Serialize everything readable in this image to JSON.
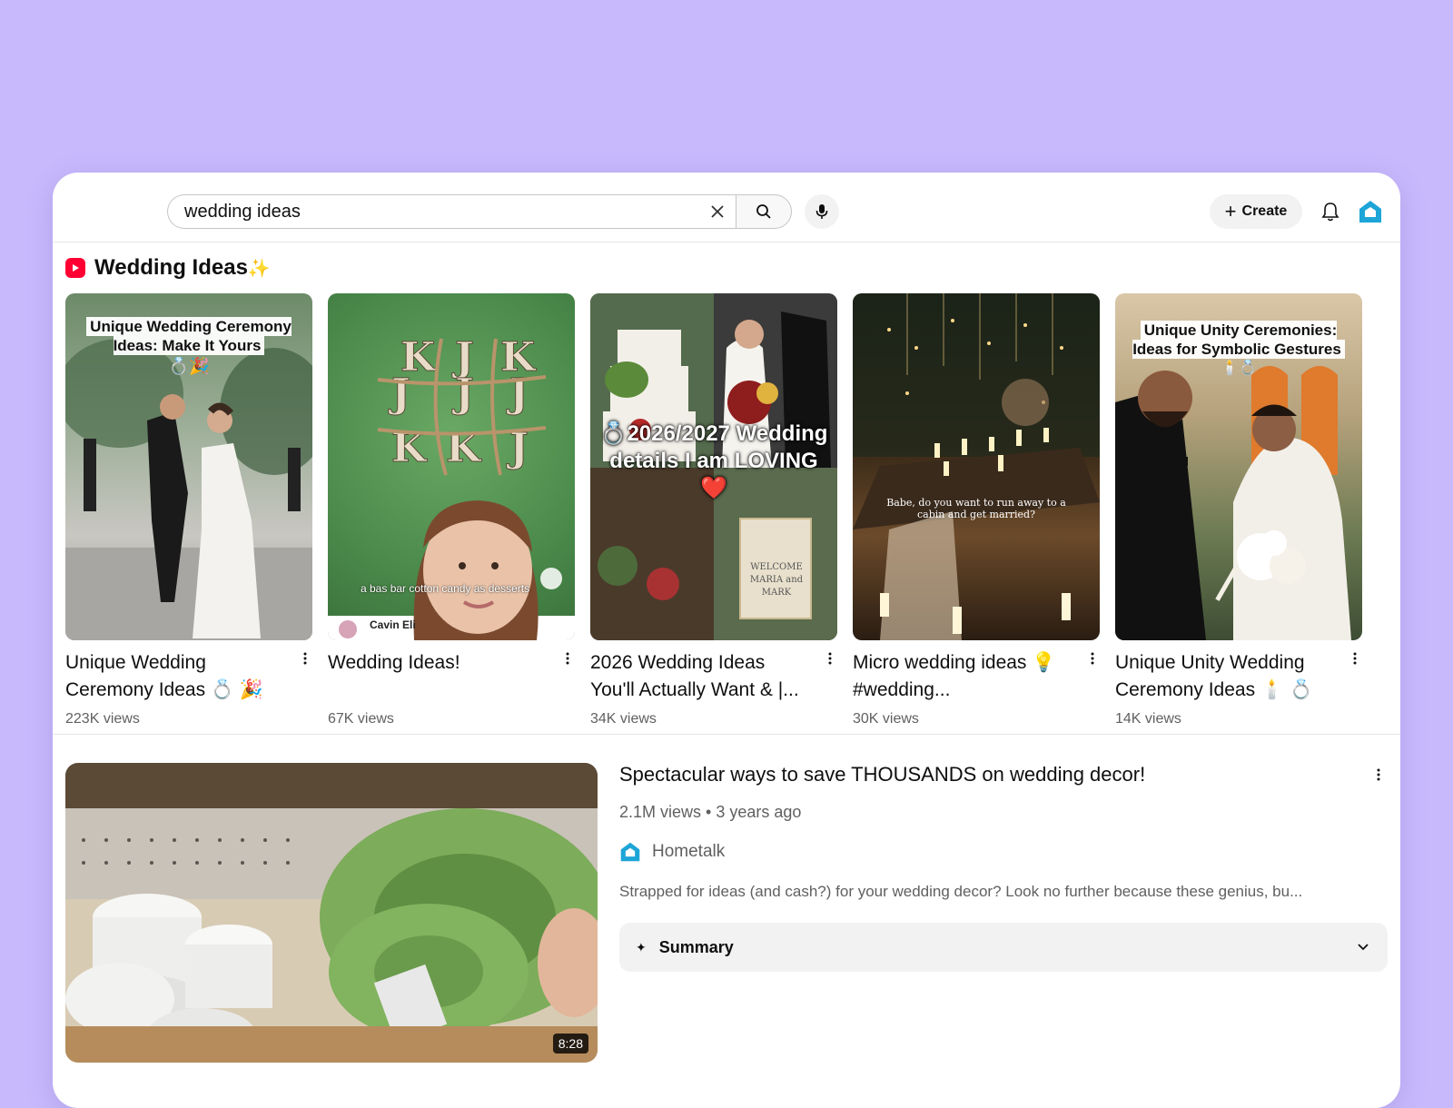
{
  "search": {
    "query": "wedding ideas"
  },
  "header": {
    "create_label": "Create"
  },
  "shelf": {
    "title": "Wedding Ideas",
    "sparkle": "✨",
    "cards": [
      {
        "overlay": "Unique Wedding Ceremony Ideas: Make It Yours",
        "overlay_emoji": "💍🎉",
        "title": "Unique Wedding Ceremony Ideas 💍 🎉 ...",
        "views": "223K views"
      },
      {
        "overlay": "",
        "overlay_small": "a bas bar cotton candy as desserts",
        "overlay_name": "Cavin Eli",
        "title": "Wedding Ideas!",
        "views": "67K views"
      },
      {
        "overlay": "💍2026/2027 Wedding details I am LOVING ❤️",
        "sign_text": "WELCOME MARIA and MARK",
        "title": "2026 Wedding Ideas You'll Actually Want & |...",
        "views": "34K views"
      },
      {
        "overlay": "",
        "overlay_small": "Babe, do you want to run away to a cabin and get married?",
        "title": "Micro wedding ideas 💡 #wedding...",
        "views": "30K views"
      },
      {
        "overlay": "Unique Unity Ceremonies: Ideas for Symbolic Gestures",
        "overlay_emoji": "🕯️💍",
        "title": "Unique Unity Wedding Ceremony Ideas 🕯️ 💍 ...",
        "views": "14K views"
      }
    ]
  },
  "video": {
    "title": "Spectacular ways to save THOUSANDS on wedding decor!",
    "views": "2.1M views",
    "age": "3 years ago",
    "separator": "•",
    "channel": "Hometalk",
    "description": "Strapped for ideas (and cash?) for your wedding decor? Look no further because these genius, bu...",
    "duration": "8:28",
    "summary_label": "Summary"
  },
  "colors": {
    "background": "#c8b9fc",
    "brand_red": "#ff0033",
    "hometalk_blue": "#1ea5d8"
  },
  "icons": [
    "clear-icon",
    "search-icon",
    "mic-icon",
    "plus-icon",
    "bell-icon",
    "hometalk-icon",
    "shorts-icon",
    "more-vert-icon",
    "sparkle-icon",
    "chevron-down-icon"
  ]
}
